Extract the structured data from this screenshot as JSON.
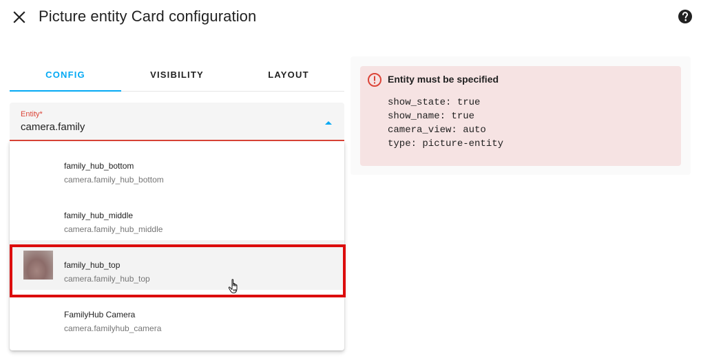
{
  "dialog": {
    "title": "Picture entity Card configuration"
  },
  "tabs": [
    {
      "label": "CONFIG",
      "active": true
    },
    {
      "label": "VISIBILITY",
      "active": false
    },
    {
      "label": "LAYOUT",
      "active": false
    }
  ],
  "entity_field": {
    "label": "Entity*",
    "value": "camera.family"
  },
  "dropdown": {
    "options": [
      {
        "name": "family_hub_bottom",
        "entity_id": "camera.family_hub_bottom",
        "has_thumbnail": false
      },
      {
        "name": "family_hub_middle",
        "entity_id": "camera.family_hub_middle",
        "has_thumbnail": false
      },
      {
        "name": "family_hub_top",
        "entity_id": "camera.family_hub_top",
        "has_thumbnail": true,
        "highlighted": true
      },
      {
        "name": "FamilyHub Camera",
        "entity_id": "camera.familyhub_camera",
        "has_thumbnail": false
      }
    ]
  },
  "preview": {
    "error_title": "Entity must be specified",
    "yaml_lines": [
      "show_state: true",
      "show_name: true",
      "camera_view: auto",
      "type: picture-entity"
    ]
  },
  "colors": {
    "accent": "#03a9f4",
    "error": "#db4437",
    "highlight_border": "#dc0d0d",
    "error_background": "#f6e3e3"
  },
  "icons": {
    "close": "close-icon",
    "help": "help-circle-icon",
    "caret": "caret-up-icon",
    "error": "alert-circle-icon",
    "pointer": "hand-pointer-icon"
  }
}
